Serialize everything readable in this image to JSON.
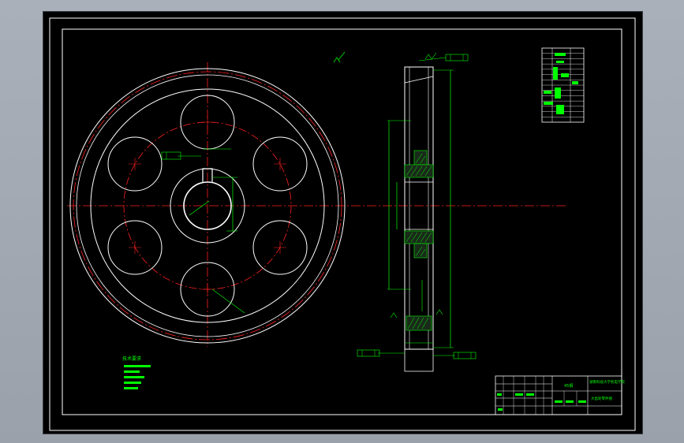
{
  "drawing": {
    "background": "#000000",
    "frame_color": "#ffffff",
    "outline_color": "#ffffff",
    "centerline_color": "#ff2020",
    "dimension_color": "#00ff00",
    "hatch_color": "#00ff00"
  },
  "labels": {
    "tech_req_title": "技术要求",
    "material": "45钢",
    "roughness_top": "Ra3.2"
  },
  "params_table": {
    "rows": 14
  },
  "title_block": {
    "part_name": "45钢",
    "school": "湖南科技大学机电学院",
    "drawing_name": "大齿轮零件图"
  }
}
